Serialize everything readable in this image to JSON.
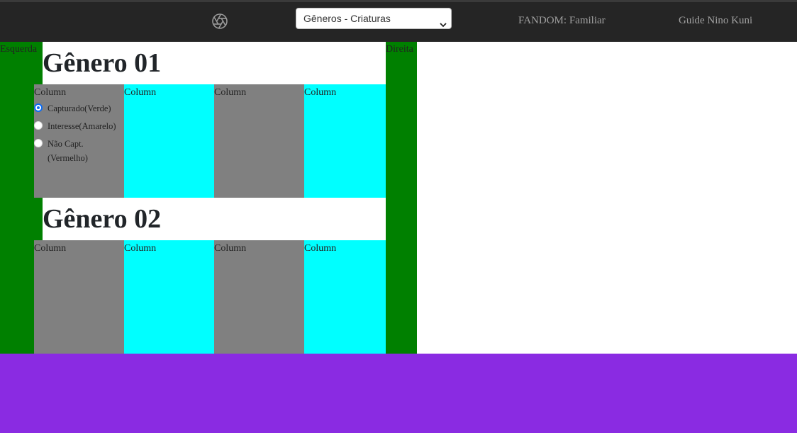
{
  "nav": {
    "select": {
      "value": "Gêneros - Criaturas"
    },
    "links": [
      {
        "label": "FANDOM: Familiar"
      },
      {
        "label": "Guide Nino Kuni"
      }
    ]
  },
  "sidebar": {
    "left_label": "Esquerda",
    "right_label": "Direita"
  },
  "sections": [
    {
      "title": "Gênero 01",
      "columns": [
        "Column",
        "Column",
        "Column",
        "Column"
      ],
      "options": [
        {
          "label": "Capturado(Verde)",
          "checked": true
        },
        {
          "label": "Interesse(Amarelo)",
          "checked": false
        },
        {
          "label": "Não Capt.\n(Vermelho)",
          "checked": false
        }
      ]
    },
    {
      "title": "Gênero 02",
      "columns": [
        "Column",
        "Column",
        "Column",
        "Column"
      ]
    }
  ],
  "colors": {
    "topbar": "#252525",
    "side": "#008000",
    "column_gray": "#808080",
    "column_cyan": "#00ffff",
    "footer": "#8a2be2",
    "radio_checked": "#0b6cf5"
  },
  "icons": {
    "logo": "aperture-icon",
    "select_arrow": "chevron-down-icon"
  }
}
